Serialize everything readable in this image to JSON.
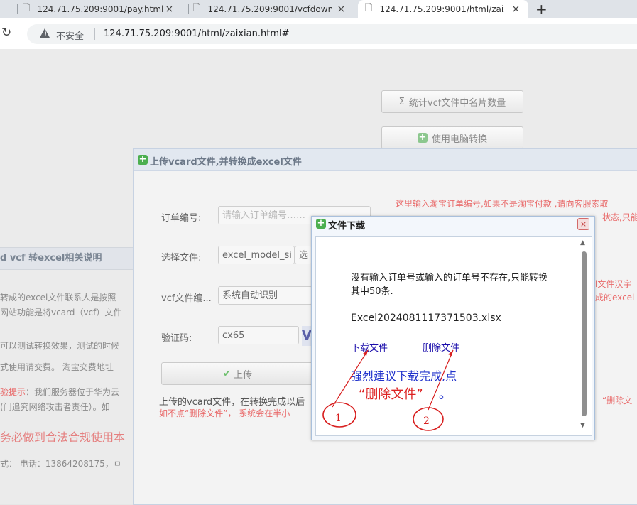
{
  "browser": {
    "tabs": [
      {
        "title": "124.71.75.209:9001/pay.html"
      },
      {
        "title": "124.71.75.209:9001/vcfdownload"
      },
      {
        "title": "124.71.75.209:9001/html/zaixian."
      }
    ],
    "new_tab": "+",
    "close_glyph": "×",
    "reload_glyph": "↻",
    "security_label": "不安全",
    "url": "124.71.75.209:9001/html/zaixian.html#"
  },
  "page": {
    "count_button": "统计vcf文件中名片数量",
    "count_button_icon": "Σ",
    "pc_convert_button": "使用电脑转换",
    "left_section_title": "d vcf 转excel相关说明",
    "left_lines": [
      " 转成的excel文件联系人是按照",
      "网站功能是将vcard（vcf）文件",
      "可以测试转换效果，测试的时候",
      "式使用请交费。     淘宝交费地址",
      "(门追究网络攻击者责任）。如",
      "务必做到合法合规使用本",
      "式：  电话：13864208175，ㅁ"
    ],
    "experience_prefix": "验提示",
    "experience_text": "：我们服务器位于华为云"
  },
  "upload_panel": {
    "title": "上传vcard文件,并转换成excel文件",
    "order_label": "订单编号:",
    "order_placeholder": "请输入订单编号……",
    "file_label": "选择文件:",
    "file_value": "excel_model_si",
    "file_button": "选",
    "encoding_label": "vcf文件编...",
    "encoding_value": "系统自动识别",
    "captcha_label": "验证码:",
    "captcha_value": "cx65",
    "upload_button": "上传",
    "red_note_1": "这里输入淘宝订单编号,如果不是淘宝付款 ,请向客服索取",
    "red_note_2": "状态,只能",
    "red_note_3": "l文件汉字",
    "red_note_4": "成的excel",
    "bottom_note_1": "上传的vcard文件，在转换完成以后",
    "bottom_note_2": "如不点“删除文件”，  系统会在半小",
    "bottom_note_right": "“删除文"
  },
  "modal": {
    "title": "文件下载",
    "message": "没有输入订单号或输入的订单号不存在,只能转换其中50条.",
    "filename": "Excel2024081117371503.xlsx",
    "download_link": "下载文件",
    "delete_link": "删除文件",
    "advice_line1": "强烈建议下载完成,点",
    "advice_line2": "“删除文件”",
    "advice_end": "。",
    "close_glyph": "×",
    "scroll_up": "▲",
    "scroll_down": "▼"
  },
  "annotations": {
    "label_1": "1",
    "label_2": "2",
    "color": "#d81e1e"
  }
}
